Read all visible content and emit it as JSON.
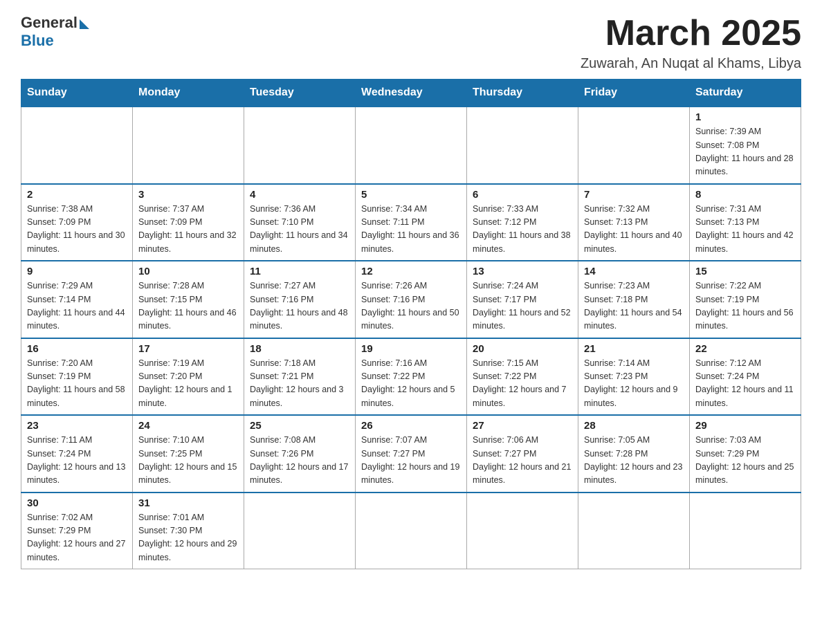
{
  "header": {
    "logo_general": "General",
    "logo_blue": "Blue",
    "month_year": "March 2025",
    "location": "Zuwarah, An Nuqat al Khams, Libya"
  },
  "weekdays": [
    "Sunday",
    "Monday",
    "Tuesday",
    "Wednesday",
    "Thursday",
    "Friday",
    "Saturday"
  ],
  "weeks": [
    [
      {
        "day": "",
        "sunrise": "",
        "sunset": "",
        "daylight": ""
      },
      {
        "day": "",
        "sunrise": "",
        "sunset": "",
        "daylight": ""
      },
      {
        "day": "",
        "sunrise": "",
        "sunset": "",
        "daylight": ""
      },
      {
        "day": "",
        "sunrise": "",
        "sunset": "",
        "daylight": ""
      },
      {
        "day": "",
        "sunrise": "",
        "sunset": "",
        "daylight": ""
      },
      {
        "day": "",
        "sunrise": "",
        "sunset": "",
        "daylight": ""
      },
      {
        "day": "1",
        "sunrise": "Sunrise: 7:39 AM",
        "sunset": "Sunset: 7:08 PM",
        "daylight": "Daylight: 11 hours and 28 minutes."
      }
    ],
    [
      {
        "day": "2",
        "sunrise": "Sunrise: 7:38 AM",
        "sunset": "Sunset: 7:09 PM",
        "daylight": "Daylight: 11 hours and 30 minutes."
      },
      {
        "day": "3",
        "sunrise": "Sunrise: 7:37 AM",
        "sunset": "Sunset: 7:09 PM",
        "daylight": "Daylight: 11 hours and 32 minutes."
      },
      {
        "day": "4",
        "sunrise": "Sunrise: 7:36 AM",
        "sunset": "Sunset: 7:10 PM",
        "daylight": "Daylight: 11 hours and 34 minutes."
      },
      {
        "day": "5",
        "sunrise": "Sunrise: 7:34 AM",
        "sunset": "Sunset: 7:11 PM",
        "daylight": "Daylight: 11 hours and 36 minutes."
      },
      {
        "day": "6",
        "sunrise": "Sunrise: 7:33 AM",
        "sunset": "Sunset: 7:12 PM",
        "daylight": "Daylight: 11 hours and 38 minutes."
      },
      {
        "day": "7",
        "sunrise": "Sunrise: 7:32 AM",
        "sunset": "Sunset: 7:13 PM",
        "daylight": "Daylight: 11 hours and 40 minutes."
      },
      {
        "day": "8",
        "sunrise": "Sunrise: 7:31 AM",
        "sunset": "Sunset: 7:13 PM",
        "daylight": "Daylight: 11 hours and 42 minutes."
      }
    ],
    [
      {
        "day": "9",
        "sunrise": "Sunrise: 7:29 AM",
        "sunset": "Sunset: 7:14 PM",
        "daylight": "Daylight: 11 hours and 44 minutes."
      },
      {
        "day": "10",
        "sunrise": "Sunrise: 7:28 AM",
        "sunset": "Sunset: 7:15 PM",
        "daylight": "Daylight: 11 hours and 46 minutes."
      },
      {
        "day": "11",
        "sunrise": "Sunrise: 7:27 AM",
        "sunset": "Sunset: 7:16 PM",
        "daylight": "Daylight: 11 hours and 48 minutes."
      },
      {
        "day": "12",
        "sunrise": "Sunrise: 7:26 AM",
        "sunset": "Sunset: 7:16 PM",
        "daylight": "Daylight: 11 hours and 50 minutes."
      },
      {
        "day": "13",
        "sunrise": "Sunrise: 7:24 AM",
        "sunset": "Sunset: 7:17 PM",
        "daylight": "Daylight: 11 hours and 52 minutes."
      },
      {
        "day": "14",
        "sunrise": "Sunrise: 7:23 AM",
        "sunset": "Sunset: 7:18 PM",
        "daylight": "Daylight: 11 hours and 54 minutes."
      },
      {
        "day": "15",
        "sunrise": "Sunrise: 7:22 AM",
        "sunset": "Sunset: 7:19 PM",
        "daylight": "Daylight: 11 hours and 56 minutes."
      }
    ],
    [
      {
        "day": "16",
        "sunrise": "Sunrise: 7:20 AM",
        "sunset": "Sunset: 7:19 PM",
        "daylight": "Daylight: 11 hours and 58 minutes."
      },
      {
        "day": "17",
        "sunrise": "Sunrise: 7:19 AM",
        "sunset": "Sunset: 7:20 PM",
        "daylight": "Daylight: 12 hours and 1 minute."
      },
      {
        "day": "18",
        "sunrise": "Sunrise: 7:18 AM",
        "sunset": "Sunset: 7:21 PM",
        "daylight": "Daylight: 12 hours and 3 minutes."
      },
      {
        "day": "19",
        "sunrise": "Sunrise: 7:16 AM",
        "sunset": "Sunset: 7:22 PM",
        "daylight": "Daylight: 12 hours and 5 minutes."
      },
      {
        "day": "20",
        "sunrise": "Sunrise: 7:15 AM",
        "sunset": "Sunset: 7:22 PM",
        "daylight": "Daylight: 12 hours and 7 minutes."
      },
      {
        "day": "21",
        "sunrise": "Sunrise: 7:14 AM",
        "sunset": "Sunset: 7:23 PM",
        "daylight": "Daylight: 12 hours and 9 minutes."
      },
      {
        "day": "22",
        "sunrise": "Sunrise: 7:12 AM",
        "sunset": "Sunset: 7:24 PM",
        "daylight": "Daylight: 12 hours and 11 minutes."
      }
    ],
    [
      {
        "day": "23",
        "sunrise": "Sunrise: 7:11 AM",
        "sunset": "Sunset: 7:24 PM",
        "daylight": "Daylight: 12 hours and 13 minutes."
      },
      {
        "day": "24",
        "sunrise": "Sunrise: 7:10 AM",
        "sunset": "Sunset: 7:25 PM",
        "daylight": "Daylight: 12 hours and 15 minutes."
      },
      {
        "day": "25",
        "sunrise": "Sunrise: 7:08 AM",
        "sunset": "Sunset: 7:26 PM",
        "daylight": "Daylight: 12 hours and 17 minutes."
      },
      {
        "day": "26",
        "sunrise": "Sunrise: 7:07 AM",
        "sunset": "Sunset: 7:27 PM",
        "daylight": "Daylight: 12 hours and 19 minutes."
      },
      {
        "day": "27",
        "sunrise": "Sunrise: 7:06 AM",
        "sunset": "Sunset: 7:27 PM",
        "daylight": "Daylight: 12 hours and 21 minutes."
      },
      {
        "day": "28",
        "sunrise": "Sunrise: 7:05 AM",
        "sunset": "Sunset: 7:28 PM",
        "daylight": "Daylight: 12 hours and 23 minutes."
      },
      {
        "day": "29",
        "sunrise": "Sunrise: 7:03 AM",
        "sunset": "Sunset: 7:29 PM",
        "daylight": "Daylight: 12 hours and 25 minutes."
      }
    ],
    [
      {
        "day": "30",
        "sunrise": "Sunrise: 7:02 AM",
        "sunset": "Sunset: 7:29 PM",
        "daylight": "Daylight: 12 hours and 27 minutes."
      },
      {
        "day": "31",
        "sunrise": "Sunrise: 7:01 AM",
        "sunset": "Sunset: 7:30 PM",
        "daylight": "Daylight: 12 hours and 29 minutes."
      },
      {
        "day": "",
        "sunrise": "",
        "sunset": "",
        "daylight": ""
      },
      {
        "day": "",
        "sunrise": "",
        "sunset": "",
        "daylight": ""
      },
      {
        "day": "",
        "sunrise": "",
        "sunset": "",
        "daylight": ""
      },
      {
        "day": "",
        "sunrise": "",
        "sunset": "",
        "daylight": ""
      },
      {
        "day": "",
        "sunrise": "",
        "sunset": "",
        "daylight": ""
      }
    ]
  ]
}
